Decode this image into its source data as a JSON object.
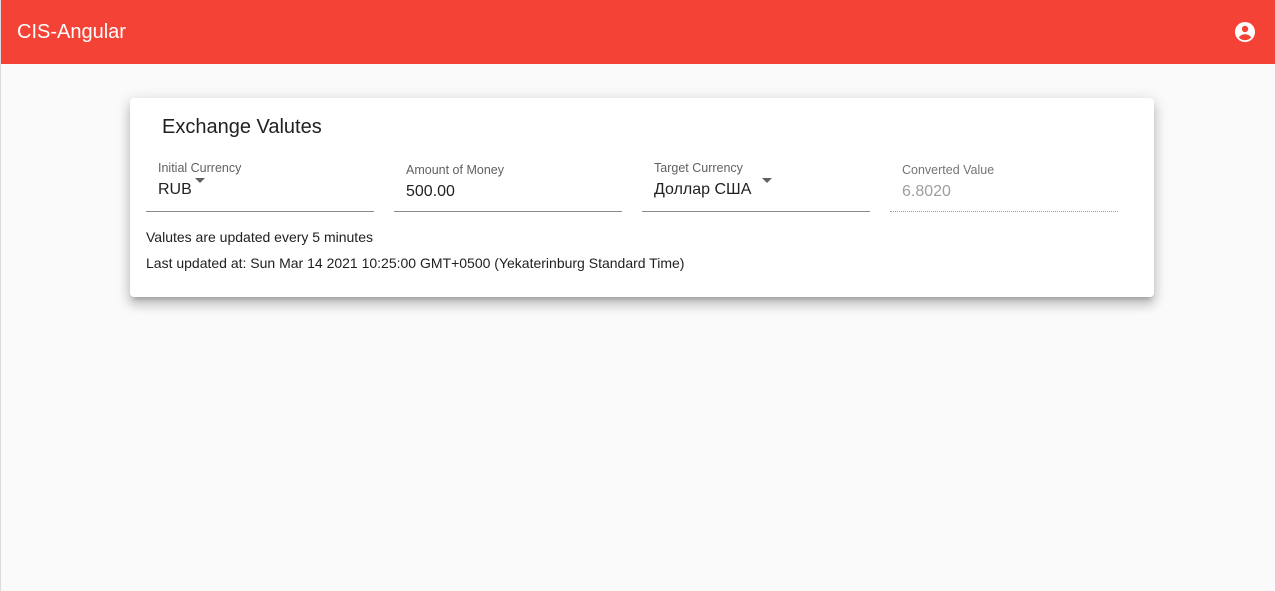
{
  "app": {
    "title": "CIS-Angular",
    "account_icon": "account-circle-icon",
    "toolbar_color": "#f44336"
  },
  "card": {
    "title": "Exchange Valutes",
    "fields": {
      "initial_currency": {
        "label": "Initial Currency",
        "value": "RUB"
      },
      "amount": {
        "label": "Amount of Money",
        "value": "500.00"
      },
      "target_currency": {
        "label": "Target Currency",
        "value": "Доллар США"
      },
      "converted": {
        "label": "Converted Value",
        "value": "6.8020"
      }
    },
    "update_note": "Valutes are updated every 5 minutes",
    "last_updated": "Last updated at: Sun Mar 14 2021 10:25:00 GMT+0500 (Yekaterinburg Standard Time)"
  }
}
